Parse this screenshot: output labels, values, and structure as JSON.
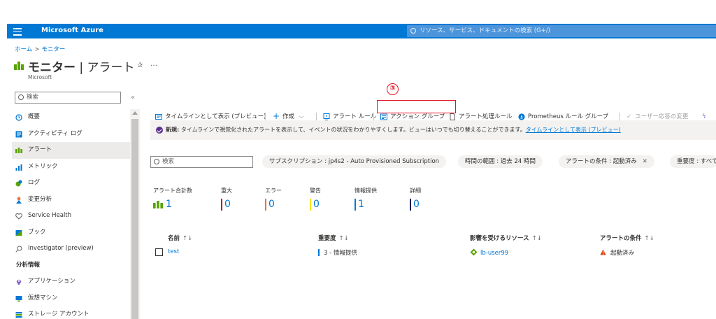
{
  "header": {
    "brand": "Microsoft Azure",
    "search_placeholder": "リソース、サービス、ドキュメントの検索 (G+/)"
  },
  "breadcrumb": {
    "home": "ホーム",
    "sep": ">",
    "current": "モニター"
  },
  "page": {
    "title_bold": "モニター",
    "title_sep": " | ",
    "title_rest": "アラート",
    "subtitle": "Microsoft",
    "more": "…"
  },
  "sidebar": {
    "search_placeholder": "検索",
    "collapse": "«",
    "items": [
      {
        "label": "概要"
      },
      {
        "label": "アクティビティ ログ"
      },
      {
        "label": "アラート"
      },
      {
        "label": "メトリック"
      },
      {
        "label": "ログ"
      },
      {
        "label": "変更分析"
      },
      {
        "label": "Service Health"
      },
      {
        "label": "ブック"
      },
      {
        "label": "Investigator (preview)"
      }
    ],
    "section_header": "分析情報",
    "insights": [
      {
        "label": "アプリケーション"
      },
      {
        "label": "仮想マシン"
      },
      {
        "label": "ストレージ アカウント"
      }
    ]
  },
  "toolbar": {
    "timeline": "タイムラインとして表示 (プレビュー)",
    "create": "作成",
    "alert_rules": "アラート ルール",
    "action_groups": "アクション グループ",
    "processing_rules": "アラート処理ルール",
    "prometheus": "Prometheus ルール グループ",
    "user_response": "ユーザー応答の変更"
  },
  "annotation": {
    "step": "③"
  },
  "banner": {
    "bold": "新規:",
    "text": " タイムラインで視覚化されたアラートを表示して、イベントの状況をわかりやすくします。ビューはいつでも切り替えることができます。",
    "link": "タイムラインとして表示 (プレビュー)"
  },
  "filters": {
    "search_placeholder": "検索",
    "pills": [
      {
        "label": "サブスクリプション : jp4s2 - Auto Provisioned Subscription"
      },
      {
        "label": "時間の範囲 : 過去 24 時間"
      },
      {
        "label": "アラートの条件 : 起動済み"
      },
      {
        "label": "重要度 : すべて"
      }
    ]
  },
  "summary": {
    "items": [
      {
        "label": "アラート合計数",
        "value": "1",
        "color": "#57a300"
      },
      {
        "label": "重大",
        "value": "0",
        "color": "#c50f1f"
      },
      {
        "label": "エラー",
        "value": "0",
        "color": "#e97548"
      },
      {
        "label": "警告",
        "value": "0",
        "color": "#fce100"
      },
      {
        "label": "情報提供",
        "value": "1",
        "color": "#0078d4"
      },
      {
        "label": "詳細",
        "value": "0",
        "color": "#002050"
      }
    ]
  },
  "table": {
    "headers": [
      "名前",
      "重要度",
      "影響を受けるリソース",
      "アラートの条件"
    ],
    "sort_indicator": "↑↓",
    "rows": [
      {
        "name": "test",
        "severity": "3 - 情報提供",
        "resource": "lb-user99",
        "condition": "起動済み"
      }
    ]
  },
  "colors": {
    "accent": "#0078d4",
    "highlight": "#e81123",
    "alert_green": "#57a300"
  }
}
